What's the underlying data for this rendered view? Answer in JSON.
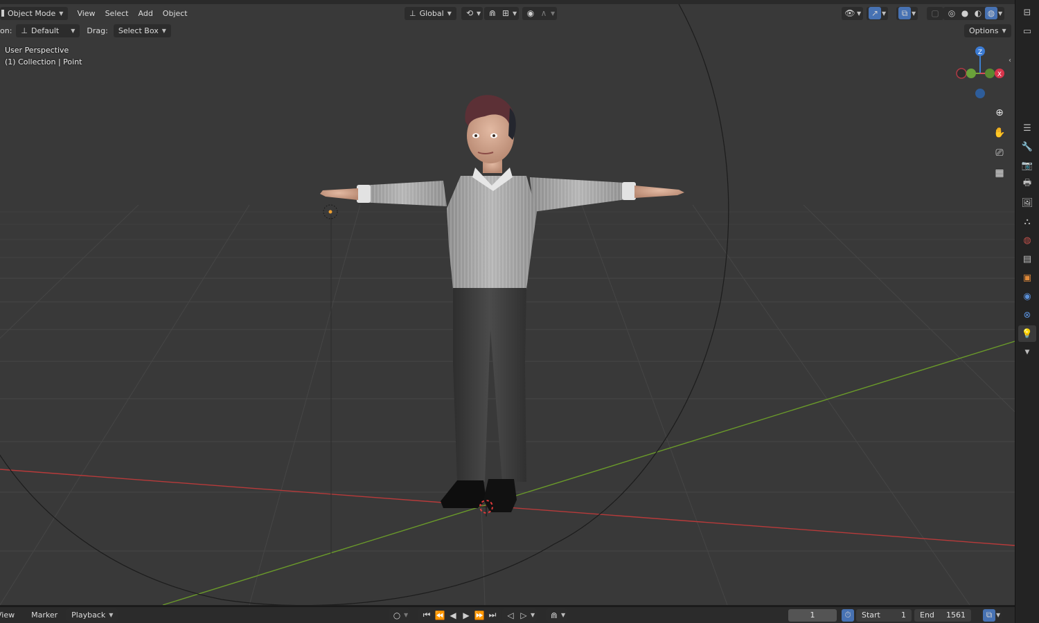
{
  "header": {
    "mode": "Object Mode",
    "menus": [
      "View",
      "Select",
      "Add",
      "Object"
    ],
    "orientation": "Global",
    "options": "Options"
  },
  "toolbar": {
    "orientation_label": "on:",
    "pivot": "Default",
    "drag_label": "Drag:",
    "drag_value": "Select Box"
  },
  "overlay": {
    "perspective": "User Perspective",
    "collection": "(1) Collection | Point"
  },
  "gizmo": {
    "z": "Z",
    "x": "X"
  },
  "timeline": {
    "menus": [
      "View",
      "Marker",
      "Playback"
    ],
    "current_frame": "1",
    "start_label": "Start",
    "start_value": "1",
    "end_label": "End",
    "end_value": "1561"
  },
  "colors": {
    "viewport_bg": "#393939",
    "x_axis": "#c23838",
    "y_axis": "#6e9a2c",
    "accent": "#4772b3"
  }
}
